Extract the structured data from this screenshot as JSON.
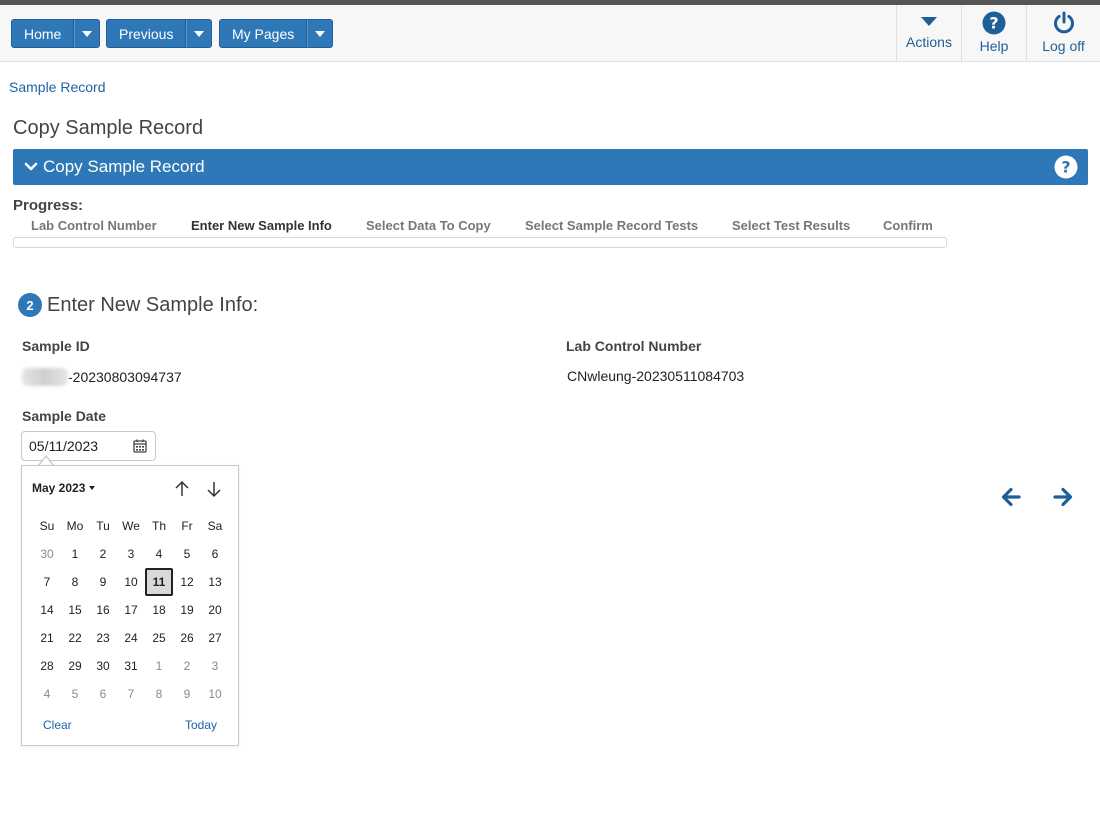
{
  "nav": {
    "home_label": "Home",
    "previous_label": "Previous",
    "mypages_label": "My Pages"
  },
  "top_actions": {
    "actions_label": "Actions",
    "help_label": "Help",
    "logoff_label": "Log off"
  },
  "breadcrumb": {
    "label": "Sample Record"
  },
  "page_title": "Copy Sample Record",
  "panel": {
    "title": "Copy Sample Record"
  },
  "progress": {
    "label": "Progress:",
    "steps": [
      "Lab Control Number",
      "Enter New Sample Info",
      "Select Data To Copy",
      "Select Sample Record Tests",
      "Select Test Results",
      "Confirm"
    ],
    "active_index": 1
  },
  "section": {
    "number": "2",
    "title": "Enter New Sample Info:"
  },
  "fields": {
    "sample_id_label": "Sample ID",
    "sample_id_value": "-20230803094737",
    "lab_control_label": "Lab Control Number",
    "lab_control_value": "CNwleung-20230511084703",
    "sample_date_label": "Sample Date",
    "sample_date_value": "05/11/2023"
  },
  "datepicker": {
    "month_label": "May 2023",
    "weekdays": [
      "Su",
      "Mo",
      "Tu",
      "We",
      "Th",
      "Fr",
      "Sa"
    ],
    "weeks": [
      [
        "30",
        "1",
        "2",
        "3",
        "4",
        "5",
        "6"
      ],
      [
        "7",
        "8",
        "9",
        "10",
        "11",
        "12",
        "13"
      ],
      [
        "14",
        "15",
        "16",
        "17",
        "18",
        "19",
        "20"
      ],
      [
        "21",
        "22",
        "23",
        "24",
        "25",
        "26",
        "27"
      ],
      [
        "28",
        "29",
        "30",
        "31",
        "1",
        "2",
        "3"
      ],
      [
        "4",
        "5",
        "6",
        "7",
        "8",
        "9",
        "10"
      ]
    ],
    "selected_day": "11",
    "clear_label": "Clear",
    "today_label": "Today"
  },
  "colors": {
    "accent": "#2f78b8",
    "link": "#1f63a5"
  }
}
